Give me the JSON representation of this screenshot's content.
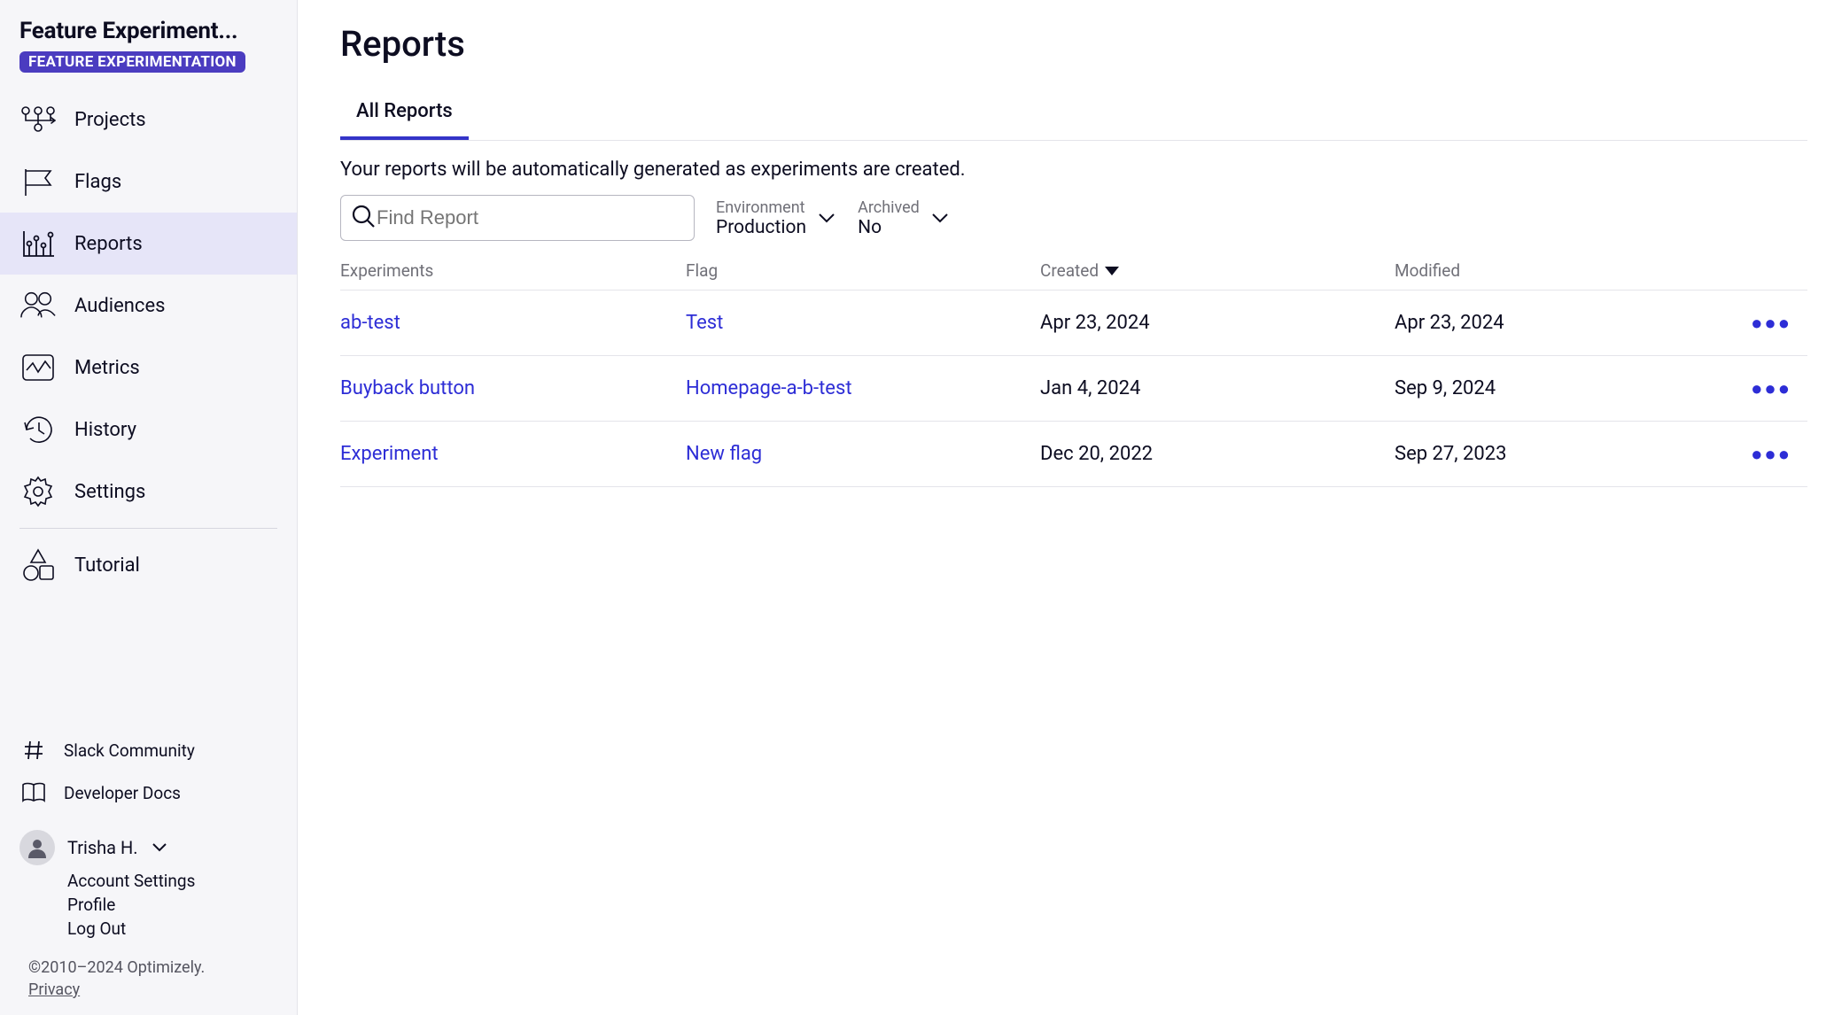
{
  "sidebar": {
    "title": "Feature Experiment...",
    "badge": "FEATURE EXPERIMENTATION",
    "nav": [
      {
        "label": "Projects",
        "icon": "projects"
      },
      {
        "label": "Flags",
        "icon": "flag"
      },
      {
        "label": "Reports",
        "icon": "chart",
        "active": true
      },
      {
        "label": "Audiences",
        "icon": "audiences"
      },
      {
        "label": "Metrics",
        "icon": "metrics"
      },
      {
        "label": "History",
        "icon": "history"
      },
      {
        "label": "Settings",
        "icon": "gear"
      }
    ],
    "tutorial": "Tutorial",
    "ext": [
      {
        "label": "Slack Community",
        "icon": "hash"
      },
      {
        "label": "Developer Docs",
        "icon": "book"
      }
    ],
    "user": {
      "name": "Trisha H.",
      "menu": [
        "Account Settings",
        "Profile",
        "Log Out"
      ]
    },
    "copyright": "©2010–2024 Optimizely.",
    "privacy": "Privacy"
  },
  "page": {
    "title": "Reports",
    "tabs": [
      "All Reports"
    ],
    "active_tab": 0,
    "help_text": "Your reports will be automatically generated as experiments are created.",
    "search_placeholder": "Find Report",
    "filters": {
      "environment": {
        "label": "Environment",
        "value": "Production"
      },
      "archived": {
        "label": "Archived",
        "value": "No"
      }
    },
    "columns": [
      "Experiments",
      "Flag",
      "Created",
      "Modified"
    ],
    "sort_col": "Created",
    "rows": [
      {
        "experiment": "ab-test",
        "flag": "Test",
        "created": "Apr 23, 2024",
        "modified": "Apr 23, 2024"
      },
      {
        "experiment": "Buyback button",
        "flag": "Homepage-a-b-test",
        "created": "Jan 4, 2024",
        "modified": "Sep 9, 2024"
      },
      {
        "experiment": "Experiment",
        "flag": "New flag",
        "created": "Dec 20, 2022",
        "modified": "Sep 27, 2023"
      }
    ]
  }
}
